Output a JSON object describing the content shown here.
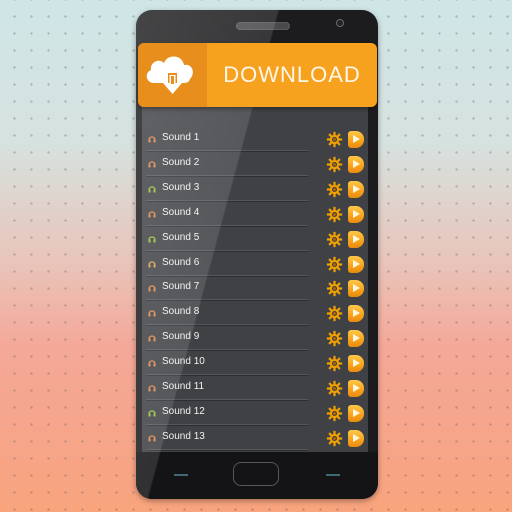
{
  "banner": {
    "label": "DOWNLOAD",
    "icon": "cloud-download-icon",
    "colors": {
      "main": "#f6a21e",
      "icon_box": "#e88e1c",
      "text": "#fff6ea"
    }
  },
  "sound_list": {
    "item_icon": "headphones-icon",
    "action_icons": [
      "gear-icon",
      "play-icon"
    ],
    "items": [
      {
        "label": "Sound 1",
        "icon_color": "#e0874a"
      },
      {
        "label": "Sound 2",
        "icon_color": "#e0874a"
      },
      {
        "label": "Sound 3",
        "icon_color": "#9ac23c"
      },
      {
        "label": "Sound 4",
        "icon_color": "#e0874a"
      },
      {
        "label": "Sound 5",
        "icon_color": "#9ac23c"
      },
      {
        "label": "Sound 6",
        "icon_color": "#e0a04a"
      },
      {
        "label": "Sound 7",
        "icon_color": "#e0874a"
      },
      {
        "label": "Sound 8",
        "icon_color": "#e0874a"
      },
      {
        "label": "Sound 9",
        "icon_color": "#e0874a"
      },
      {
        "label": "Sound 10",
        "icon_color": "#e0874a"
      },
      {
        "label": "Sound 11",
        "icon_color": "#e0874a"
      },
      {
        "label": "Sound 12",
        "icon_color": "#9ac23c"
      },
      {
        "label": "Sound 13",
        "icon_color": "#e0874a"
      }
    ]
  },
  "colors": {
    "accent": "#f6a21e",
    "gear": "#f0a000",
    "list_bg": "#3f4145"
  }
}
